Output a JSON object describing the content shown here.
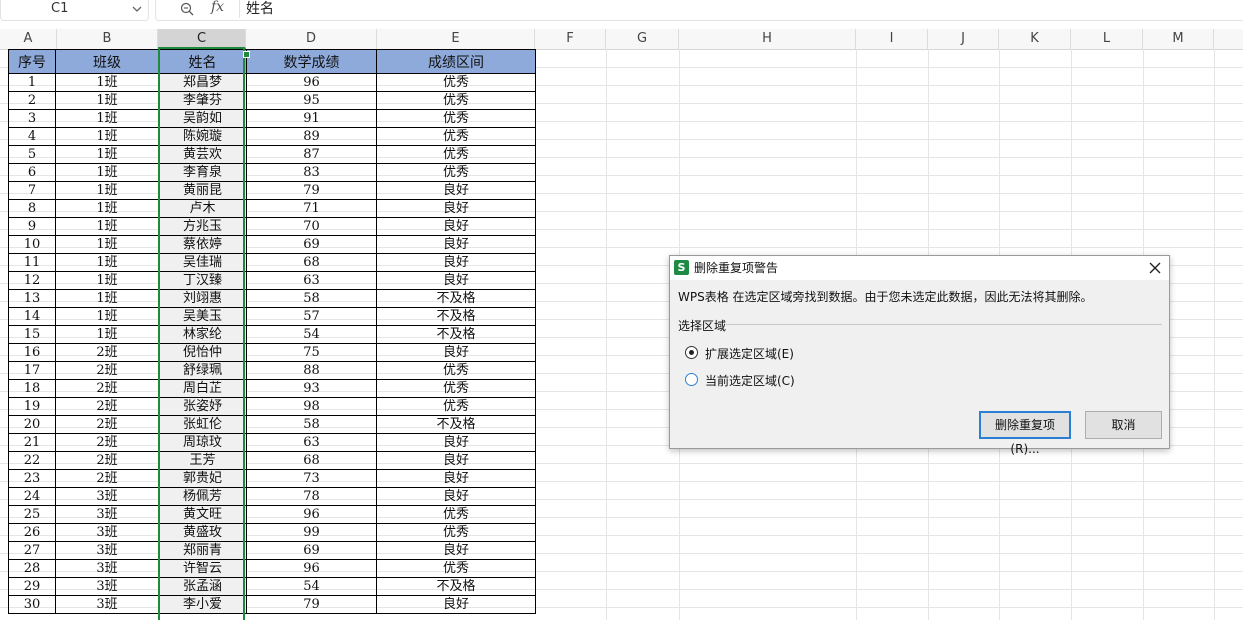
{
  "formula_bar": {
    "cell_ref": "C1",
    "fx_label": "fx",
    "content": "姓名"
  },
  "columns": [
    "A",
    "B",
    "C",
    "D",
    "E",
    "F",
    "G",
    "H",
    "I",
    "J",
    "K",
    "L",
    "M"
  ],
  "table": {
    "headers": [
      "序号",
      "班级",
      "姓名",
      "数学成绩",
      "成绩区间"
    ],
    "rows": [
      [
        "1",
        "1班",
        "郑昌梦",
        "96",
        "优秀"
      ],
      [
        "2",
        "1班",
        "李肇芬",
        "95",
        "优秀"
      ],
      [
        "3",
        "1班",
        "吴韵如",
        "91",
        "优秀"
      ],
      [
        "4",
        "1班",
        "陈婉璇",
        "89",
        "优秀"
      ],
      [
        "5",
        "1班",
        "黄芸欢",
        "87",
        "优秀"
      ],
      [
        "6",
        "1班",
        "李育泉",
        "83",
        "优秀"
      ],
      [
        "7",
        "1班",
        "黄丽昆",
        "79",
        "良好"
      ],
      [
        "8",
        "1班",
        "卢木",
        "71",
        "良好"
      ],
      [
        "9",
        "1班",
        "方兆玉",
        "70",
        "良好"
      ],
      [
        "10",
        "1班",
        "蔡依婷",
        "69",
        "良好"
      ],
      [
        "11",
        "1班",
        "吴佳瑞",
        "68",
        "良好"
      ],
      [
        "12",
        "1班",
        "丁汉臻",
        "63",
        "良好"
      ],
      [
        "13",
        "1班",
        "刘翊惠",
        "58",
        "不及格"
      ],
      [
        "14",
        "1班",
        "吴美玉",
        "57",
        "不及格"
      ],
      [
        "15",
        "1班",
        "林家纶",
        "54",
        "不及格"
      ],
      [
        "16",
        "2班",
        "倪怡仲",
        "75",
        "良好"
      ],
      [
        "17",
        "2班",
        "舒绿珮",
        "88",
        "优秀"
      ],
      [
        "18",
        "2班",
        "周白芷",
        "93",
        "优秀"
      ],
      [
        "19",
        "2班",
        "张姿妤",
        "98",
        "优秀"
      ],
      [
        "20",
        "2班",
        "张虹伦",
        "58",
        "不及格"
      ],
      [
        "21",
        "2班",
        "周琼玟",
        "63",
        "良好"
      ],
      [
        "22",
        "2班",
        "王芳",
        "68",
        "良好"
      ],
      [
        "23",
        "2班",
        "郭贵妃",
        "73",
        "良好"
      ],
      [
        "24",
        "3班",
        "杨佩芳",
        "78",
        "良好"
      ],
      [
        "25",
        "3班",
        "黄文旺",
        "96",
        "优秀"
      ],
      [
        "26",
        "3班",
        "黄盛玫",
        "99",
        "优秀"
      ],
      [
        "27",
        "3班",
        "郑丽青",
        "69",
        "良好"
      ],
      [
        "28",
        "3班",
        "许智云",
        "96",
        "优秀"
      ],
      [
        "29",
        "3班",
        "张孟涵",
        "54",
        "不及格"
      ],
      [
        "30",
        "3班",
        "李小爱",
        "79",
        "良好"
      ]
    ]
  },
  "dialog": {
    "title": "删除重复项警告",
    "message": "WPS表格 在选定区域旁找到数据。由于您未选定此数据，因此无法将其删除。",
    "group_label": "选择区域",
    "option_expand": "扩展选定区域(E)",
    "option_current": "当前选定区域(C)",
    "selected_option": "expand",
    "btn_remove": "删除重复项(R)...",
    "btn_cancel": "取消"
  },
  "colors": {
    "header_fill": "#8eaadb",
    "selection_green": "#1f8a3c",
    "focus_blue": "#2a7fd4"
  }
}
